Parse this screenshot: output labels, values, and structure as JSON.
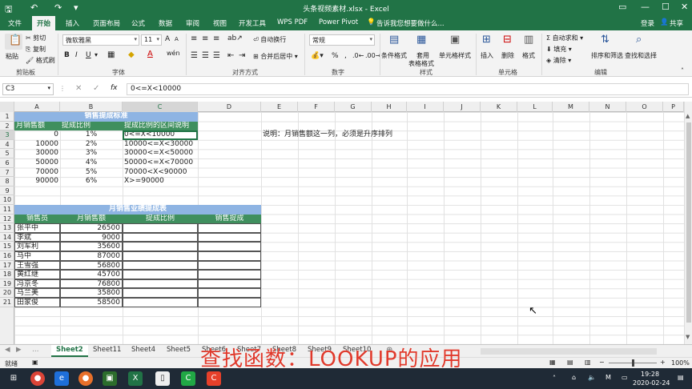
{
  "window": {
    "title": "头条视频素材.xlsx - Excel"
  },
  "tabs": [
    "文件",
    "开始",
    "插入",
    "页面布局",
    "公式",
    "数据",
    "审阅",
    "视图",
    "开发工具",
    "WPS PDF",
    "Power Pivot"
  ],
  "active_tab": "开始",
  "tell_me": "告诉我您想要做什么...",
  "account": {
    "login": "登录",
    "share": "共享"
  },
  "ribbon": {
    "clipboard": {
      "paste": "粘贴",
      "cut": "剪切",
      "copy": "复制",
      "format_painter": "格式刷",
      "label": "剪贴板"
    },
    "font": {
      "name": "微软雅黑",
      "size": "11",
      "bold": "B",
      "italic": "I",
      "underline": "U",
      "grow": "A",
      "shrink": "A",
      "label": "字体"
    },
    "alignment": {
      "wrap": "自动换行",
      "merge": "合并后居中",
      "label": "对齐方式"
    },
    "number": {
      "format": "常规",
      "percent": "%",
      "comma": ",",
      "label": "数字"
    },
    "styles": {
      "conditional": "条件格式",
      "table": "套用",
      "table2": "表格格式",
      "cell_styles": "单元格样式",
      "label": "样式"
    },
    "cells": {
      "insert": "插入",
      "delete": "删除",
      "format": "格式",
      "label": "单元格"
    },
    "editing": {
      "autosum": "自动求和",
      "fill": "填充",
      "clear": "清除",
      "sort": "排序和筛选",
      "find": "查找和选择",
      "label": "编辑"
    }
  },
  "formula_bar": {
    "name_box": "C3",
    "formula": "0<=X<10000"
  },
  "columns": [
    "A",
    "B",
    "C",
    "D",
    "E",
    "F",
    "G",
    "H",
    "I",
    "J",
    "K",
    "L",
    "M",
    "N",
    "O",
    "P"
  ],
  "rows": [
    "1",
    "2",
    "3",
    "4",
    "5",
    "6",
    "7",
    "8",
    "9",
    "10",
    "11",
    "12",
    "13",
    "14",
    "15",
    "16",
    "17",
    "18",
    "19",
    "20",
    "21"
  ],
  "table1": {
    "title": "销售提成标准",
    "headers": [
      "月销售额",
      "提成比例",
      "提成比例的区间说明"
    ],
    "rows": [
      [
        "0",
        "1%",
        "0<=X<10000"
      ],
      [
        "10000",
        "2%",
        "10000<=X<30000"
      ],
      [
        "30000",
        "3%",
        "30000<=X<50000"
      ],
      [
        "50000",
        "4%",
        "50000<=X<70000"
      ],
      [
        "70000",
        "5%",
        "70000<X<90000"
      ],
      [
        "90000",
        "6%",
        "X>=90000"
      ]
    ]
  },
  "note": "说明：月销售额这一列，必须是升序排列",
  "table2": {
    "title": "月销售业绩提成表",
    "headers": [
      "销售员",
      "月销售额",
      "提成比例",
      "销售提成"
    ],
    "rows": [
      [
        "张平中",
        "26500"
      ],
      [
        "李斌",
        "9000"
      ],
      [
        "刘军利",
        "35600"
      ],
      [
        "马中",
        "87000"
      ],
      [
        "王雪强",
        "56800"
      ],
      [
        "黄红继",
        "45700"
      ],
      [
        "冯京冬",
        "76800"
      ],
      [
        "马兰美",
        "35800"
      ],
      [
        "田家俊",
        "58500"
      ]
    ]
  },
  "sheets": [
    "Sheet2",
    "Sheet11",
    "Sheet4",
    "Sheet5",
    "Sheet6",
    "Sheet7",
    "Sheet8",
    "Sheet9",
    "Sheet10"
  ],
  "active_sheet": "Sheet2",
  "status": {
    "ready": "就绪",
    "zoom": "100%"
  },
  "clock": {
    "time": "19:28",
    "date": "2020-02-24"
  },
  "overlay_caption": "查找函数：LOOKUP的应用",
  "colors": {
    "excel_green": "#217346",
    "header_blue": "#8eb4e3",
    "header_green": "#3f8f5e",
    "overlay_red": "#e0392b"
  }
}
